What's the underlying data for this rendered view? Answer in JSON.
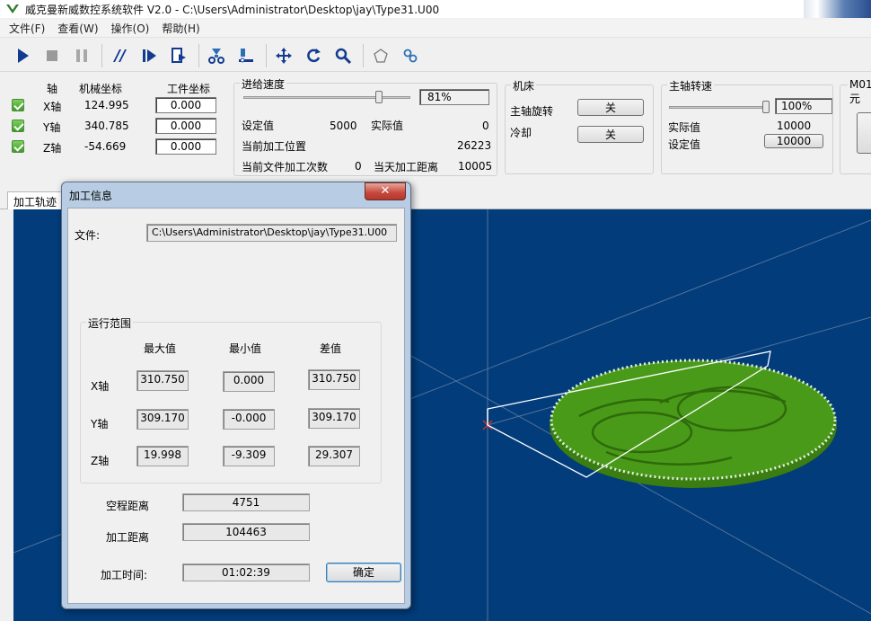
{
  "window": {
    "title": "威克曼新威数控系统软件 V2.0 - C:\\Users\\Administrator\\Desktop\\jay\\Type31.U00"
  },
  "menu": [
    "文件(F)",
    "查看(W)",
    "操作(O)",
    "帮助(H)"
  ],
  "toolbar": {
    "icons": [
      "play-icon",
      "stop-icon",
      "pause-icon",
      "step-icon",
      "step-forward-icon",
      "file-run-icon",
      "tool-home-icon",
      "tool-zero-icon",
      "move-icon",
      "rotate-icon",
      "zoom-icon",
      "polygon-icon",
      "link-icon"
    ]
  },
  "axes": {
    "header_axis": "轴",
    "header_machine": "机械坐标",
    "header_work": "工件坐标",
    "rows": [
      {
        "name": "X轴",
        "machine": "124.995",
        "work": "0.000"
      },
      {
        "name": "Y轴",
        "machine": "340.785",
        "work": "0.000"
      },
      {
        "name": "Z轴",
        "machine": "-54.669",
        "work": "0.000"
      }
    ]
  },
  "feed": {
    "title": "进给速度",
    "percent_text": "81%",
    "percent": 81,
    "set_label": "设定值",
    "set_value": "5000",
    "actual_label": "实际值",
    "actual_value": "0",
    "pos_label": "当前加工位置",
    "pos_value": "26223",
    "count_label": "当前文件加工次数",
    "count_value": "0",
    "dist_label": "当天加工距离",
    "dist_value": "10005"
  },
  "machine": {
    "title": "机床",
    "spindle_label": "主轴旋转",
    "spindle_btn": "关",
    "cool_label": "冷却",
    "cool_btn": "关"
  },
  "spindle": {
    "title": "主轴转速",
    "percent_text": "100%",
    "percent": 100,
    "actual_label": "实际值",
    "actual_value": "10000",
    "set_label": "设定值",
    "set_value": "10000"
  },
  "m01": {
    "title": "M01元"
  },
  "tabs": {
    "active": "加工轨迹"
  },
  "dialog": {
    "title": "加工信息",
    "close": "✕",
    "file_label": "文件:",
    "file_value": "C:\\Users\\Administrator\\Desktop\\jay\\Type31.U00",
    "range_title": "运行范围",
    "col_max": "最大值",
    "col_min": "最小值",
    "col_diff": "差值",
    "rows": [
      {
        "axis": "X轴",
        "max": "310.750",
        "min": "0.000",
        "diff": "310.750"
      },
      {
        "axis": "Y轴",
        "max": "309.170",
        "min": "-0.000",
        "diff": "309.170"
      },
      {
        "axis": "Z轴",
        "max": "19.998",
        "min": "-9.309",
        "diff": "29.307"
      }
    ],
    "idle_label": "空程距离",
    "idle_value": "4751",
    "cut_label": "加工距离",
    "cut_value": "104463",
    "time_label": "加工时间:",
    "time_value": "01:02:39",
    "ok": "确定"
  },
  "colors": {
    "viewport_bg": "#023c7a",
    "toolpath_green": "#3e8a12",
    "dialog_frame": "#b8cde3"
  }
}
